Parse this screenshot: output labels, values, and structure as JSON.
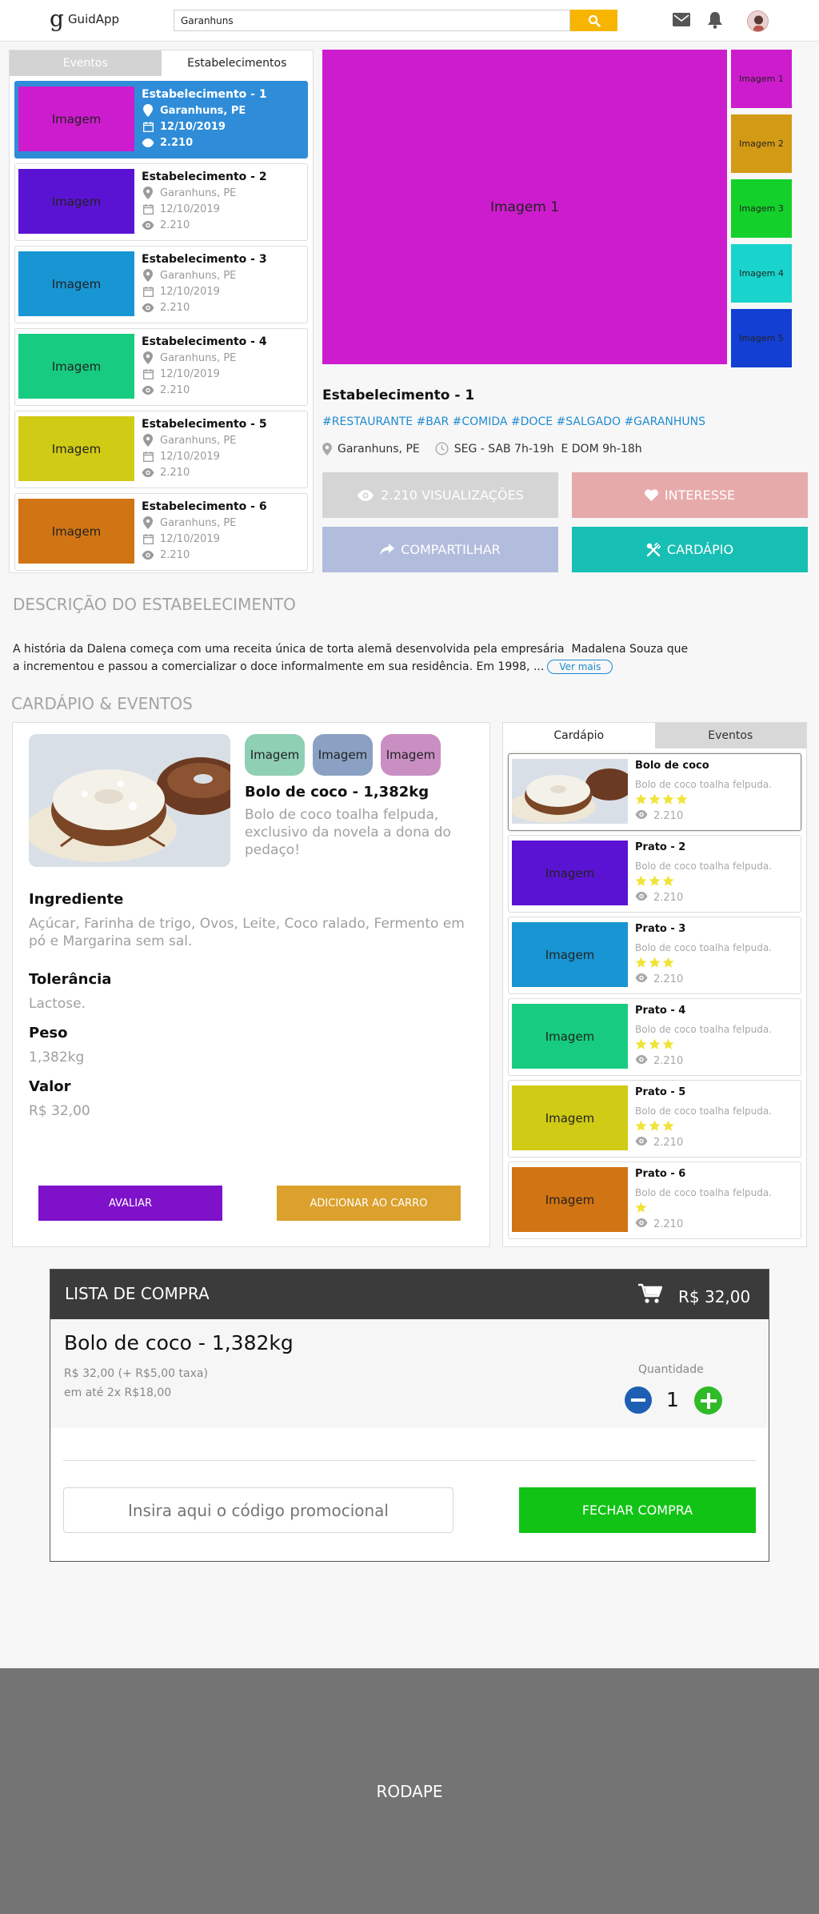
{
  "header": {
    "logo_letter": "g",
    "app_name": "GuidApp",
    "search_value": "Garanhuns",
    "accent": "#f7b500"
  },
  "left_panel": {
    "tabs": [
      {
        "label": "Eventos",
        "active": false
      },
      {
        "label": "Estabelecimentos",
        "active": true
      }
    ],
    "items": [
      {
        "image_label": "Imagem",
        "color": "#cd1ccd",
        "title": "Estabelecimento - 1",
        "location": "Garanhuns, PE",
        "date": "12/10/2019",
        "views": "2.210",
        "selected": true
      },
      {
        "image_label": "Imagem",
        "color": "#5b13d3",
        "title": "Estabelecimento - 2",
        "location": "Garanhuns, PE",
        "date": "12/10/2019",
        "views": "2.210",
        "selected": false
      },
      {
        "image_label": "Imagem",
        "color": "#1895d3",
        "title": "Estabelecimento - 3",
        "location": "Garanhuns, PE",
        "date": "12/10/2019",
        "views": "2.210",
        "selected": false
      },
      {
        "image_label": "Imagem",
        "color": "#17cc80",
        "title": "Estabelecimento - 4",
        "location": "Garanhuns, PE",
        "date": "12/10/2019",
        "views": "2.210",
        "selected": false
      },
      {
        "image_label": "Imagem",
        "color": "#d0cb14",
        "title": "Estabelecimento - 5",
        "location": "Garanhuns, PE",
        "date": "12/10/2019",
        "views": "2.210",
        "selected": false
      },
      {
        "image_label": "Imagem",
        "color": "#d17413",
        "title": "Estabelecimento - 6",
        "location": "Garanhuns, PE",
        "date": "12/10/2019",
        "views": "2.210",
        "selected": false
      }
    ]
  },
  "gallery": {
    "main_label": "Imagem 1",
    "main_color": "#cd1ccd",
    "thumbs": [
      {
        "label": "Imagem 1",
        "color": "#cd1ccd"
      },
      {
        "label": "Imagem 2",
        "color": "#d39a16"
      },
      {
        "label": "Imagem 3",
        "color": "#13d12a"
      },
      {
        "label": "Imagem 4",
        "color": "#19d4cc"
      },
      {
        "label": "Imagem 5",
        "color": "#1340d3"
      }
    ]
  },
  "establishment": {
    "title": "Estabelecimento - 1",
    "tags": "#RESTAURANTE #BAR #COMIDA #DOCE #SALGADO #GARANHUNS",
    "location": "Garanhuns, PE",
    "hours": "SEG - SAB 7h-19h  E DOM 9h-18h",
    "buttons": {
      "views": "2.210 VISUALIZAÇÕES",
      "interest": "INTERESSE",
      "share": "COMPARTILHAR",
      "menu": "CARDÁPIO"
    }
  },
  "description": {
    "title": "DESCRIÇÃO DO ESTABELECIMENTO",
    "line1": "A história da Dalena começa com uma receita única de torta alemã desenvolvida pela empresária  Madalena Souza que",
    "line2": "a incrementou e passou a comercializar o doce informalmente em sua residência. Em 1998, ...",
    "more": "Ver mais"
  },
  "menu_section": {
    "title": "CARDÁPIO & EVENTOS"
  },
  "product": {
    "chips": [
      {
        "label": "Imagem",
        "color": "#8fcfb4"
      },
      {
        "label": "Imagem",
        "color": "#8ba1c4"
      },
      {
        "label": "Imagem",
        "color": "#c98fc3"
      }
    ],
    "name": "Bolo de coco - 1,382kg",
    "description": "Bolo de coco toalha felpuda, exclusivo da novela a dona do pedaço!",
    "ingredients_label": "Ingrediente",
    "ingredients": "Açúcar, Farinha de trigo, Ovos, Leite,  Coco ralado, Fermento em pó e Margarina sem sal.",
    "tolerance_label": "Tolerância",
    "tolerance": "Lactose.",
    "weight_label": "Peso",
    "weight": "1,382kg",
    "value_label": "Valor",
    "value": "R$ 32,00",
    "rate_button": "AVALIAR",
    "add_button": "ADICIONAR AO CARRO"
  },
  "menu_panel": {
    "tabs": [
      {
        "label": "Cardápio",
        "active": true
      },
      {
        "label": "Eventos",
        "active": false
      }
    ],
    "items": [
      {
        "image_label": "",
        "color": "#d8dde4",
        "photo": true,
        "title": "Bolo de coco",
        "desc": "Bolo de coco toalha felpuda.",
        "stars": 4,
        "views": "2.210",
        "selected": true
      },
      {
        "image_label": "Imagem",
        "color": "#5b13d3",
        "photo": false,
        "title": "Prato - 2",
        "desc": "Bolo de coco toalha felpuda.",
        "stars": 3,
        "views": "2.210",
        "selected": false
      },
      {
        "image_label": "Imagem",
        "color": "#1895d3",
        "photo": false,
        "title": "Prato - 3",
        "desc": "Bolo de coco toalha felpuda.",
        "stars": 3,
        "views": "2.210",
        "selected": false
      },
      {
        "image_label": "Imagem",
        "color": "#17cc80",
        "photo": false,
        "title": "Prato - 4",
        "desc": "Bolo de coco toalha felpuda.",
        "stars": 3,
        "views": "2.210",
        "selected": false
      },
      {
        "image_label": "Imagem",
        "color": "#d0cb14",
        "photo": false,
        "title": "Prato - 5",
        "desc": "Bolo de coco toalha felpuda.",
        "stars": 3,
        "views": "2.210",
        "selected": false
      },
      {
        "image_label": "Imagem",
        "color": "#d17413",
        "photo": false,
        "title": "Prato - 6",
        "desc": "Bolo de coco toalha felpuda.",
        "stars": 1,
        "views": "2.210",
        "selected": false
      }
    ]
  },
  "cart": {
    "title": "LISTA DE COMPRA",
    "total": "R$ 32,00",
    "item_name": "Bolo de coco - 1,382kg",
    "item_price": "R$ 32,00 (+ R$5,00 taxa)",
    "installments": "em até 2x R$18,00",
    "quantity_label": "Quantidade",
    "quantity": "1",
    "promo_placeholder": "Insira aqui o código promocional",
    "checkout": "FECHAR COMPRA"
  },
  "footer": {
    "label": "RODAPE"
  }
}
